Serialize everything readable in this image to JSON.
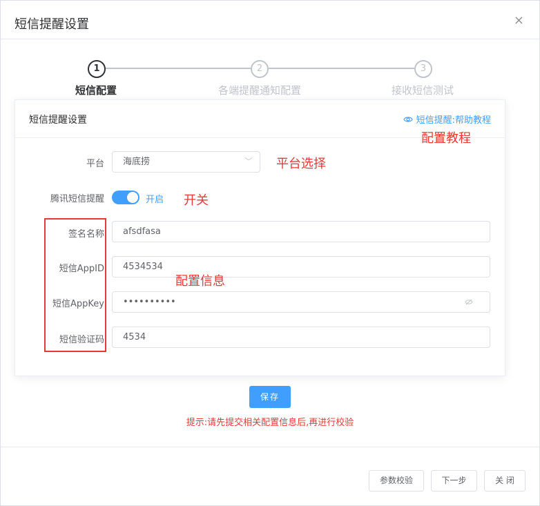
{
  "dialog": {
    "title": "短信提醒设置",
    "close_glyph": "×"
  },
  "steps": [
    {
      "index": "1",
      "label": "短信配置",
      "active": true
    },
    {
      "index": "2",
      "label": "各端提醒通知配置",
      "active": false
    },
    {
      "index": "3",
      "label": "接收短信测试",
      "active": false
    }
  ],
  "card": {
    "title": "短信提醒设置",
    "help_link": "短信提醒:帮助教程",
    "platform_label": "平台",
    "platform_value": "海底捞",
    "switch_label": "腾讯短信提醒",
    "switch_text": "开启",
    "switch_on": true,
    "sign_label": "签名名称",
    "sign_value": "afsdfasa",
    "appid_label": "短信AppID",
    "appid_value": "4534534",
    "appkey_label": "短信AppKey",
    "appkey_value": "••••••••••",
    "code_label": "短信验证码",
    "code_value": "4534"
  },
  "annotations": {
    "help": "配置教程",
    "platform": "平台选择",
    "switch": "开关",
    "config": "配置信息"
  },
  "save_label": "保存",
  "tip": "提示:请先提交相关配置信息后,再进行校验",
  "footer": {
    "check_label": "参数校验",
    "next_label": "下一步",
    "close_label": "关 闭"
  },
  "colors": {
    "primary": "#409eff",
    "annotation": "#e53935"
  }
}
